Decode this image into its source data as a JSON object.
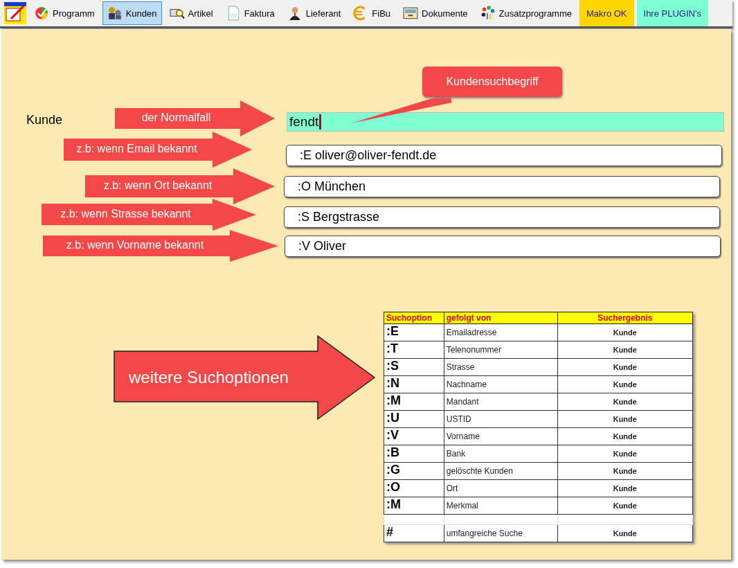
{
  "toolbar": {
    "items": [
      {
        "kind": "tool",
        "label": "Programm",
        "selected": false
      },
      {
        "kind": "tool",
        "label": "Kunden",
        "selected": true
      },
      {
        "kind": "tool",
        "label": "Artikel",
        "selected": false
      },
      {
        "kind": "tool",
        "label": "Faktura",
        "selected": false
      },
      {
        "kind": "tool",
        "label": "Lieferant",
        "selected": false
      },
      {
        "kind": "tool",
        "label": "FiBu",
        "selected": false
      },
      {
        "kind": "tool",
        "label": "Dokumente",
        "selected": false
      },
      {
        "kind": "tool",
        "label": "Zusatzprogramme",
        "selected": false
      },
      {
        "kind": "highlight",
        "label": "Makro OK",
        "color": "#ffd700"
      },
      {
        "kind": "highlight",
        "label": "Ihre PLUGIN's",
        "color": "#7fffd4"
      }
    ]
  },
  "form": {
    "label": "Kunde",
    "search_value": "fendt",
    "examples": [
      ":E oliver@oliver-fendt.de",
      ":O München",
      ":S Bergstrasse",
      ":V Oliver"
    ]
  },
  "annotations": {
    "callout": "Kundensuchbegriff",
    "arrows": [
      "der Normalfall",
      "z.b: wenn Email bekannt",
      "z.b: wenn Ort bekannt",
      "z.b: wenn Strasse bekannt",
      "z.b: wenn Vorname bekannt"
    ],
    "big_arrow": "weitere Suchoptionen"
  },
  "table": {
    "columns": [
      "Suchoption",
      "gefolgt von",
      "Suchergebnis"
    ],
    "rows": [
      {
        "kind": "option",
        "option": ":E",
        "followed_by": "Emailadresse",
        "result": "Kunde"
      },
      {
        "kind": "option",
        "option": ":T",
        "followed_by": "Telenonummer",
        "result": "Kunde"
      },
      {
        "kind": "option",
        "option": ":S",
        "followed_by": "Strasse",
        "result": "Kunde"
      },
      {
        "kind": "option",
        "option": ":N",
        "followed_by": "Nachname",
        "result": "Kunde"
      },
      {
        "kind": "option",
        "option": ":M",
        "followed_by": "Mandant",
        "result": "Kunde"
      },
      {
        "kind": "option",
        "option": ":U",
        "followed_by": "USTID",
        "result": "Kunde"
      },
      {
        "kind": "option",
        "option": ":V",
        "followed_by": "Vorname",
        "result": "Kunde"
      },
      {
        "kind": "option",
        "option": ":B",
        "followed_by": "Bank",
        "result": "Kunde"
      },
      {
        "kind": "option",
        "option": ":G",
        "followed_by": "gelöschte Kunden",
        "result": "Kunde"
      },
      {
        "kind": "option",
        "option": ":O",
        "followed_by": "Ort",
        "result": "Kunde"
      },
      {
        "kind": "option",
        "option": ":M",
        "followed_by": "Merkmal",
        "result": "Kunde"
      },
      {
        "kind": "spacer"
      },
      {
        "kind": "option",
        "option": "#",
        "followed_by": "umfangreiche Suche",
        "result": "Kunde"
      }
    ]
  }
}
